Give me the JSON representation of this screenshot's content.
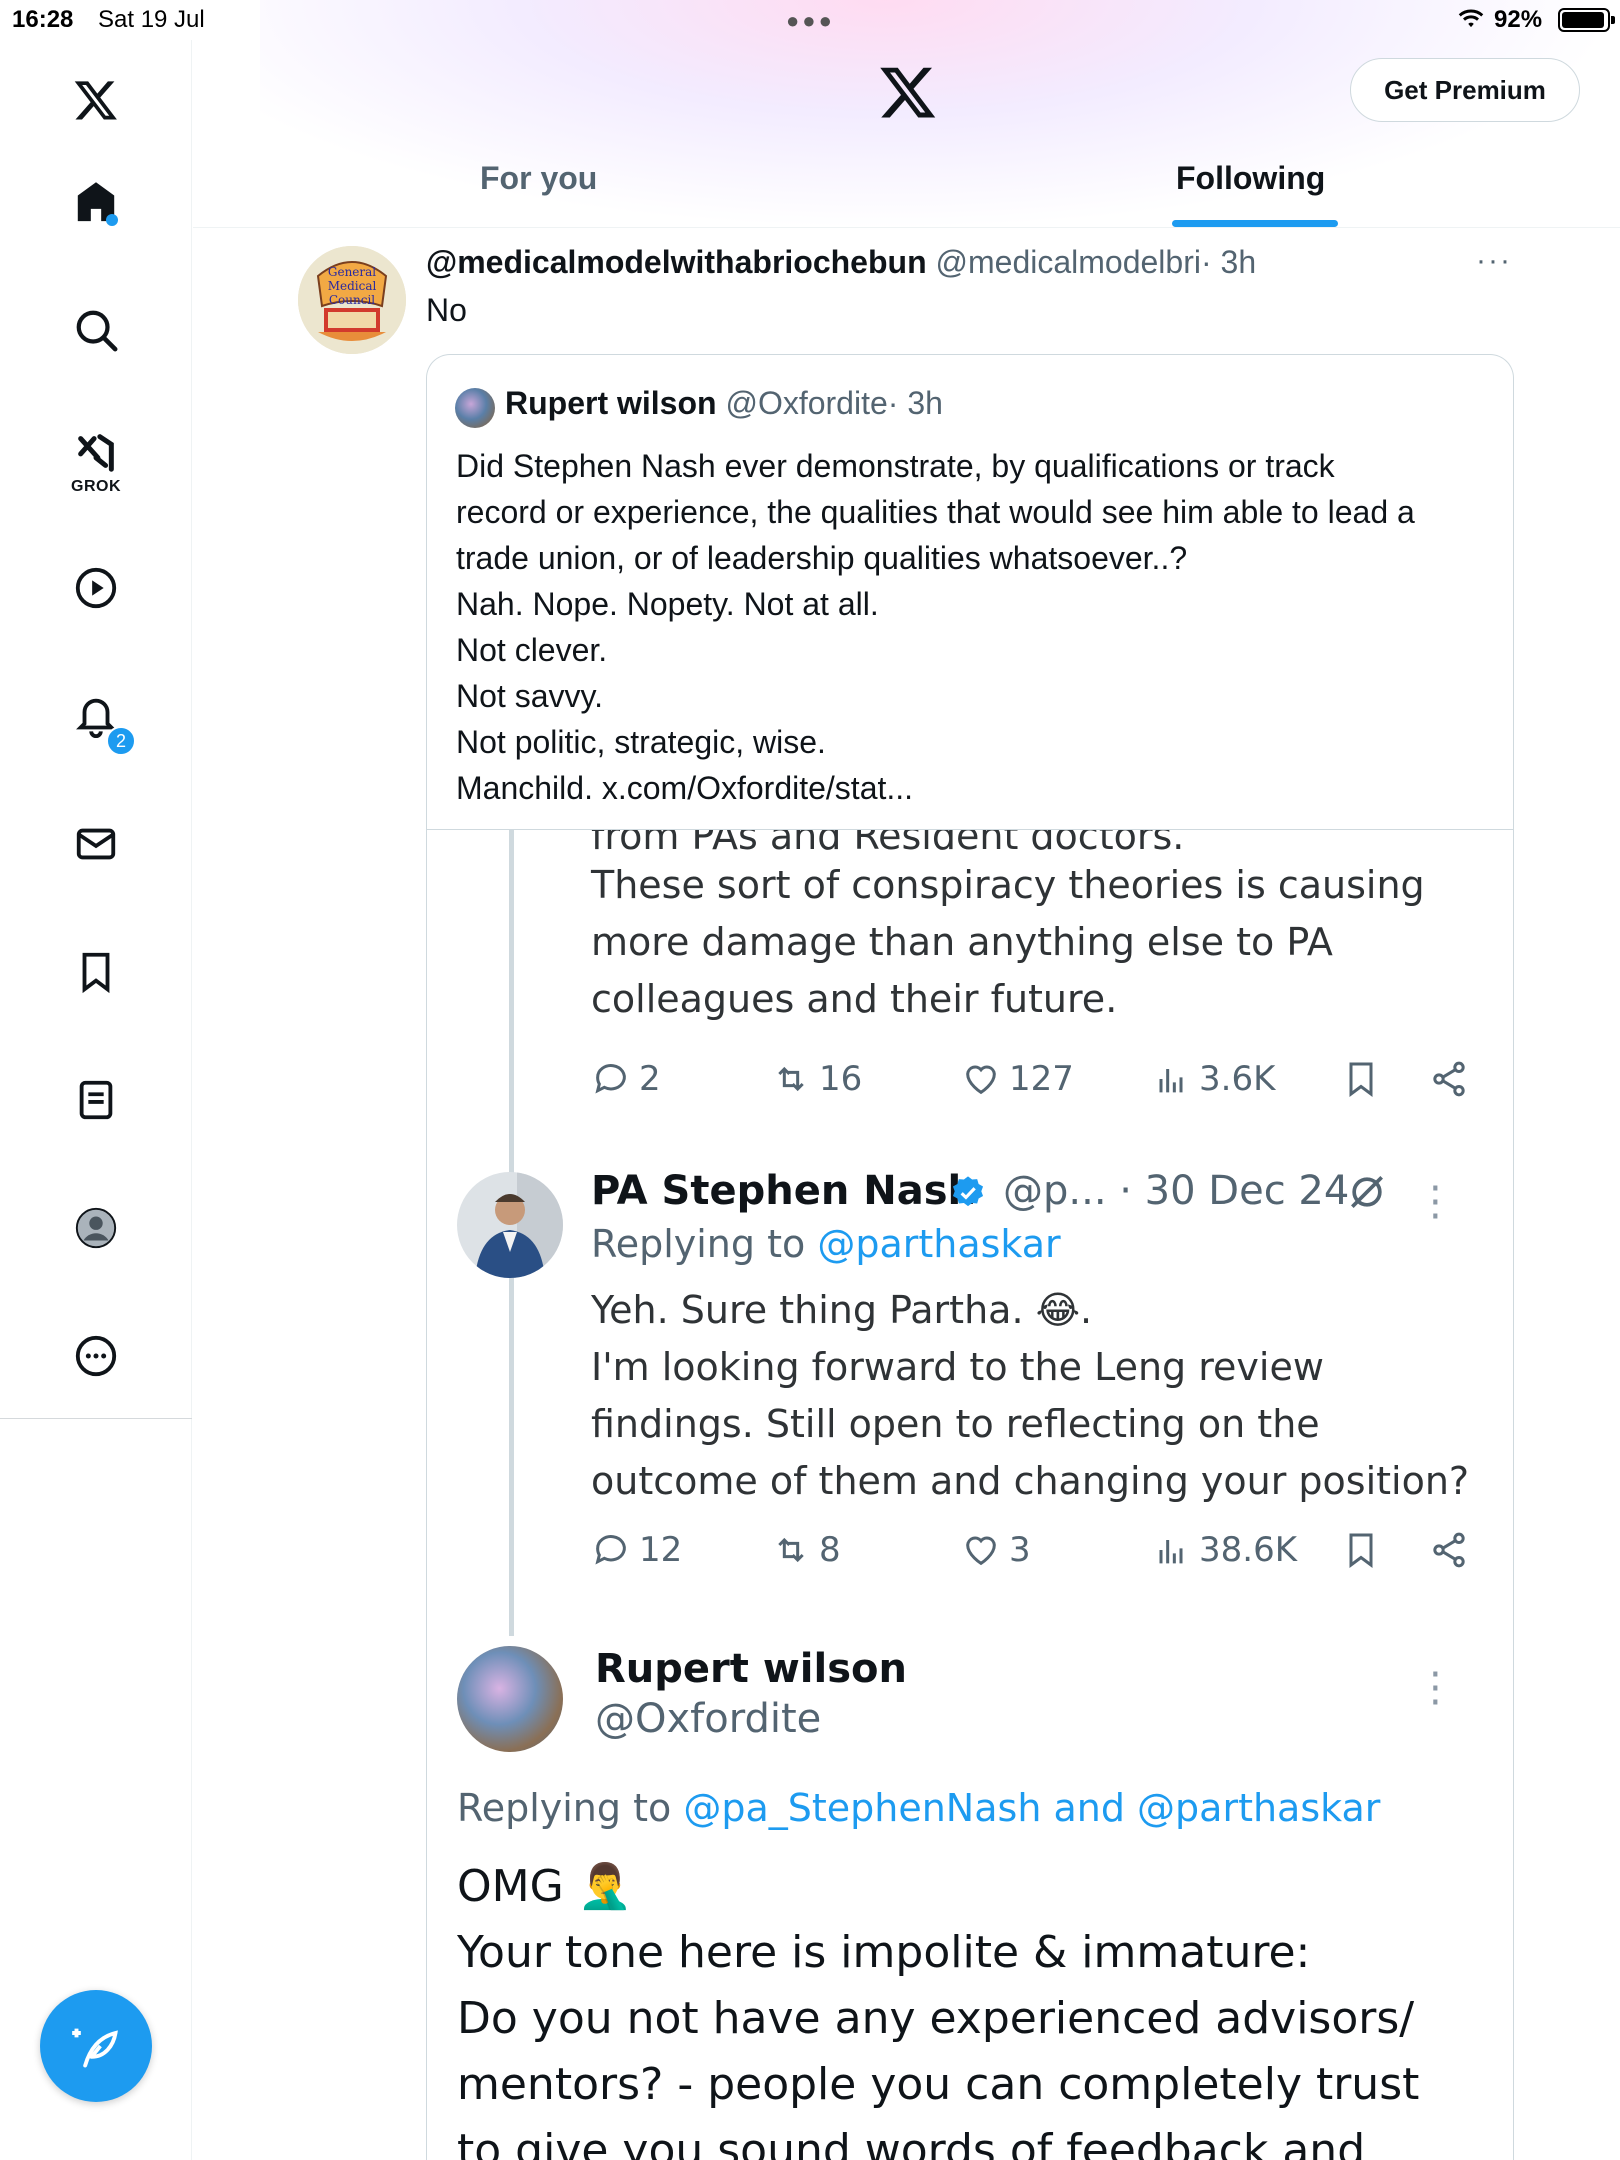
{
  "status_bar": {
    "time": "16:28",
    "date": "Sat 19 Jul",
    "battery": "92%"
  },
  "sidebar": {
    "grok_label": "GROK",
    "notifications_count": "2"
  },
  "header": {
    "premium_label": "Get Premium"
  },
  "tabs": [
    {
      "label": "For you",
      "active": false
    },
    {
      "label": "Following",
      "active": true
    }
  ],
  "post": {
    "display_name": "@medicalmodelwithabriochebun",
    "handle": "@medicalmodelbri",
    "time": "· 3h",
    "text": "No",
    "quote": {
      "display_name": "Rupert wilson",
      "handle": "@Oxfordite",
      "time": "· 3h",
      "lines": [
        "Did Stephen Nash ever demonstrate, by qualifications or track",
        "record or experience, the qualities that would see him able to lead a",
        "trade union, or of leadership qualities whatsoever..?",
        "Nah. Nope. Nopety. Not at all.",
        "Not clever.",
        "Not savvy.",
        "Not politic, strategic, wise.",
        "Manchild. x.com/Oxfordite/stat..."
      ]
    }
  },
  "screenshot": {
    "tweet1": {
      "lines": [
        "from PAs and Resident doctors.",
        "These sort of conspiracy theories is causing",
        "more damage than anything else to PA",
        "colleagues and their future."
      ],
      "replies": "2",
      "reposts": "16",
      "likes": "127",
      "views": "3.6K"
    },
    "tweet2": {
      "name": "PA Stephen Nash",
      "meta": "@p... · 30 Dec 24",
      "replying_prefix": "Replying to",
      "replying_to": "@parthaskar",
      "lines": [
        "Yeh. Sure thing Partha. 😂.",
        "I'm looking forward to the Leng review",
        "findings. Still open to reflecting on the",
        "outcome of them and changing your position?"
      ],
      "replies": "12",
      "reposts": "8",
      "likes": "3",
      "views": "38.6K"
    },
    "tweet3": {
      "name": "Rupert wilson",
      "handle": "@Oxfordite",
      "replying_prefix": "Replying to",
      "replying_to": "@pa_StephenNash and @parthaskar",
      "lines": [
        "OMG 🤦‍♂️",
        "Your tone here is impolite & immature:",
        "Do you not have any experienced advisors/",
        "mentors? - people you can completely trust",
        "to give you sound words of feedback and"
      ]
    }
  },
  "colors": {
    "accent": "#1d9bf0",
    "text": "#0f1419",
    "muted": "#536471",
    "border": "#cfd9de"
  }
}
